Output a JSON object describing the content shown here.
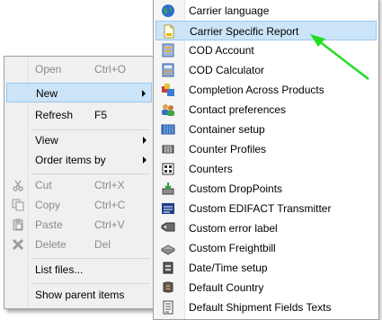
{
  "context_menu": {
    "items": [
      {
        "label": "Open",
        "shortcut": "Ctrl+O"
      },
      {
        "label": "New"
      },
      {
        "label": "Refresh",
        "shortcut": "F5"
      },
      {
        "label": "View"
      },
      {
        "label": "Order items by"
      },
      {
        "label": "Cut",
        "shortcut": "Ctrl+X"
      },
      {
        "label": "Copy",
        "shortcut": "Ctrl+C"
      },
      {
        "label": "Paste",
        "shortcut": "Ctrl+V"
      },
      {
        "label": "Delete",
        "shortcut": "Del"
      },
      {
        "label": "List files..."
      },
      {
        "label": "Show parent items"
      }
    ]
  },
  "submenu": {
    "items": [
      {
        "label": "Carrier language",
        "icon": "globe-icon"
      },
      {
        "label": "Carrier Specific Report",
        "icon": "report-icon"
      },
      {
        "label": "COD Account",
        "icon": "account-icon"
      },
      {
        "label": "COD Calculator",
        "icon": "calculator-icon"
      },
      {
        "label": "Completion Across Products",
        "icon": "completion-icon"
      },
      {
        "label": "Contact preferences",
        "icon": "contacts-icon"
      },
      {
        "label": "Container setup",
        "icon": "container-icon"
      },
      {
        "label": "Counter Profiles",
        "icon": "counter-profile-icon"
      },
      {
        "label": "Counters",
        "icon": "counters-icon"
      },
      {
        "label": "Custom DropPoints",
        "icon": "droppoint-icon"
      },
      {
        "label": "Custom EDIFACT Transmitter",
        "icon": "edifact-icon"
      },
      {
        "label": "Custom error label",
        "icon": "error-label-icon"
      },
      {
        "label": "Custom Freightbill",
        "icon": "freightbill-icon"
      },
      {
        "label": "Date/Time setup",
        "icon": "datetime-icon"
      },
      {
        "label": "Default Country",
        "icon": "country-icon"
      },
      {
        "label": "Default Shipment Fields Texts",
        "icon": "shipment-fields-icon"
      }
    ]
  },
  "colors": {
    "highlight": "#cce4f7",
    "highlight_border": "#99c9ef",
    "annotation_arrow": "#22dd22"
  }
}
